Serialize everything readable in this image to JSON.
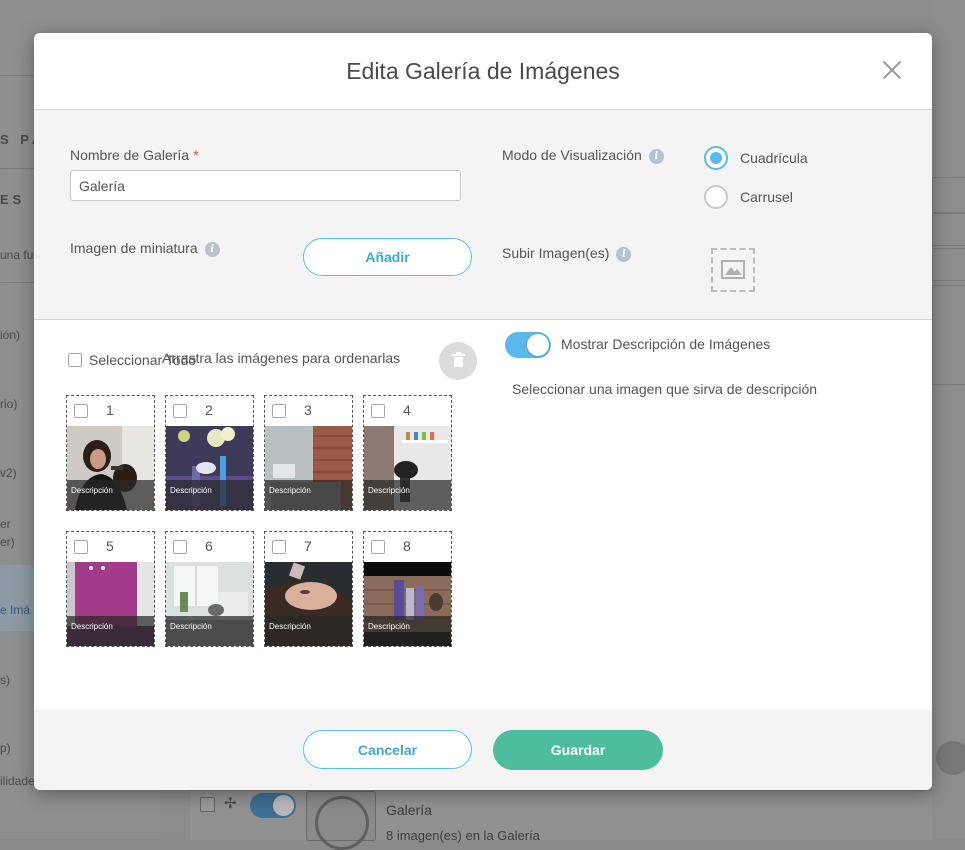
{
  "background": {
    "left_labels": [
      "S PA",
      "ES",
      "una fu",
      "ión)",
      "rio)",
      "v2)",
      "er",
      "er)",
      "e Imá",
      "s)",
      "p)",
      "ilidade"
    ],
    "row": {
      "title": "Galería",
      "subtitle": "8 imagen(es) en la Galería"
    }
  },
  "modal": {
    "title": "Edita Galería de Imágenes",
    "gallery_name": {
      "label": "Nombre de Galería",
      "required_mark": "*",
      "value": "Galería"
    },
    "thumbnail": {
      "label": "Imagen de miniatura",
      "button": "Añadir"
    },
    "display_mode": {
      "label": "Modo de Visualización",
      "options": [
        {
          "label": "Cuadrícula",
          "selected": true
        },
        {
          "label": "Carrusel",
          "selected": false
        }
      ]
    },
    "upload": {
      "label": "Subir Imagen(es)"
    },
    "select_all": "Seleccionar Todo",
    "drag_hint": "Arrastra las imágenes para ordenarlas",
    "tiles": [
      {
        "number": "1",
        "description": "Descripción"
      },
      {
        "number": "2",
        "description": "Descripción"
      },
      {
        "number": "3",
        "description": "Descripción"
      },
      {
        "number": "4",
        "description": "Descripción"
      },
      {
        "number": "5",
        "description": "Descripción"
      },
      {
        "number": "6",
        "description": "Descripción"
      },
      {
        "number": "7",
        "description": "Descripción"
      },
      {
        "number": "8",
        "description": "Descripción"
      }
    ],
    "show_description": {
      "label": "Mostrar Descripción de Imágenes",
      "enabled": true
    },
    "description_hint": "Seleccionar una imagen que sirva de descripción",
    "footer": {
      "cancel": "Cancelar",
      "save": "Guardar"
    }
  },
  "colors": {
    "accent": "#59b9ef",
    "save": "#4dbd9e",
    "required": "#e74c3c"
  }
}
